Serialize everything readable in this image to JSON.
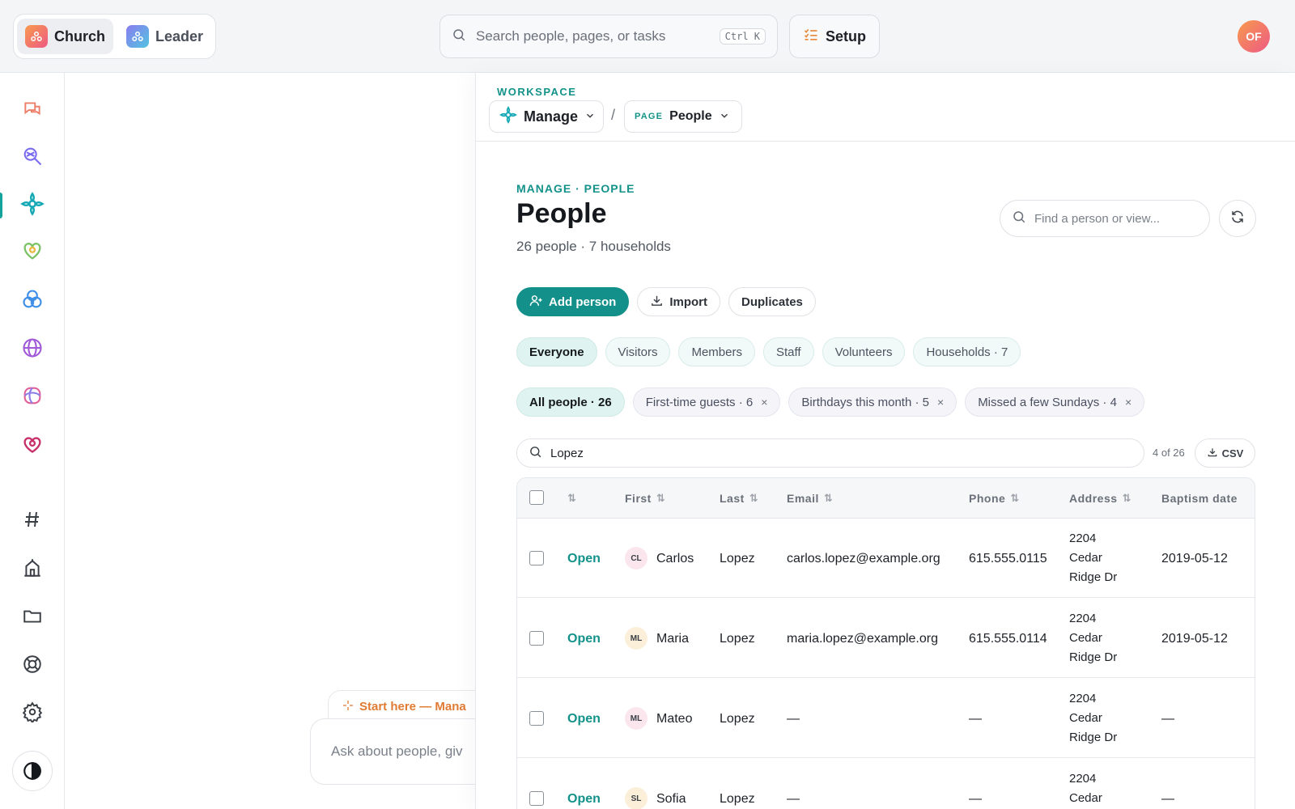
{
  "topbar": {
    "apps": [
      {
        "label": "Church",
        "active": true
      },
      {
        "label": "Leader",
        "active": false
      }
    ],
    "search_placeholder": "Search people, pages, or tasks",
    "search_shortcut": "Ctrl K",
    "setup_label": "Setup",
    "user_initials": "OF"
  },
  "rail": {
    "items": [
      "chat-icon",
      "search-people-icon",
      "manage-icon",
      "care-icon",
      "groups-icon",
      "global-icon",
      "media-icon",
      "giving-icon",
      "hashtag-icon",
      "building-icon",
      "folder-icon",
      "help-icon",
      "gear-icon"
    ],
    "active": "manage-icon"
  },
  "chat": {
    "tab_label": "Start here — Mana",
    "placeholder": "Ask about people, giv"
  },
  "breadcrumb": {
    "workspace_label": "WORKSPACE",
    "workspace": "Manage",
    "separator": "/",
    "page_tag": "PAGE",
    "page": "People"
  },
  "page": {
    "eyebrow": "MANAGE · PEOPLE",
    "title": "People",
    "subtitle": "26 people · 7 households",
    "find_placeholder": "Find a person or view..."
  },
  "actions": {
    "add_person": "Add person",
    "import": "Import",
    "duplicates": "Duplicates"
  },
  "segments": [
    {
      "label": "Everyone",
      "active": true
    },
    {
      "label": "Visitors",
      "active": false
    },
    {
      "label": "Members",
      "active": false
    },
    {
      "label": "Staff",
      "active": false
    },
    {
      "label": "Volunteers",
      "active": false
    },
    {
      "label": "Households · 7",
      "active": false
    }
  ],
  "views": [
    {
      "label": "All people · 26",
      "active": true,
      "closable": false,
      "close": ""
    },
    {
      "label": "First-time guests · 6",
      "active": false,
      "closable": true,
      "close": "×"
    },
    {
      "label": "Birthdays this month · 5",
      "active": false,
      "closable": true,
      "close": "×"
    },
    {
      "label": "Missed a few Sundays · 4",
      "active": false,
      "closable": true,
      "close": "×"
    }
  ],
  "filter": {
    "value": "Lopez",
    "count": "4 of 26",
    "csv": "CSV"
  },
  "table": {
    "sort_glyph": "⇅",
    "columns": [
      "First",
      "Last",
      "Email",
      "Phone",
      "Address",
      "Baptism date"
    ],
    "rows": [
      {
        "action": "Open",
        "initials": "CL",
        "avatar_color": "#fbe6ee",
        "first": "Carlos",
        "last": "Lopez",
        "email": "carlos.lopez@example.org",
        "phone": "615.555.0115",
        "address": [
          "2204",
          "Cedar",
          "Ridge Dr"
        ],
        "baptism": "2019-05-12"
      },
      {
        "action": "Open",
        "initials": "ML",
        "avatar_color": "#fbefd9",
        "first": "Maria",
        "last": "Lopez",
        "email": "maria.lopez@example.org",
        "phone": "615.555.0114",
        "address": [
          "2204",
          "Cedar",
          "Ridge Dr"
        ],
        "baptism": "2019-05-12"
      },
      {
        "action": "Open",
        "initials": "ML",
        "avatar_color": "#fbe6ee",
        "first": "Mateo",
        "last": "Lopez",
        "email": "—",
        "phone": "—",
        "address": [
          "2204",
          "Cedar",
          "Ridge Dr"
        ],
        "baptism": "—"
      },
      {
        "action": "Open",
        "initials": "SL",
        "avatar_color": "#fbefd9",
        "first": "Sofia",
        "last": "Lopez",
        "email": "—",
        "phone": "—",
        "address": [
          "2204",
          "Cedar"
        ],
        "baptism": "—"
      }
    ]
  },
  "colors": {
    "accent": "#14908a",
    "accent_text": "#13928a"
  }
}
